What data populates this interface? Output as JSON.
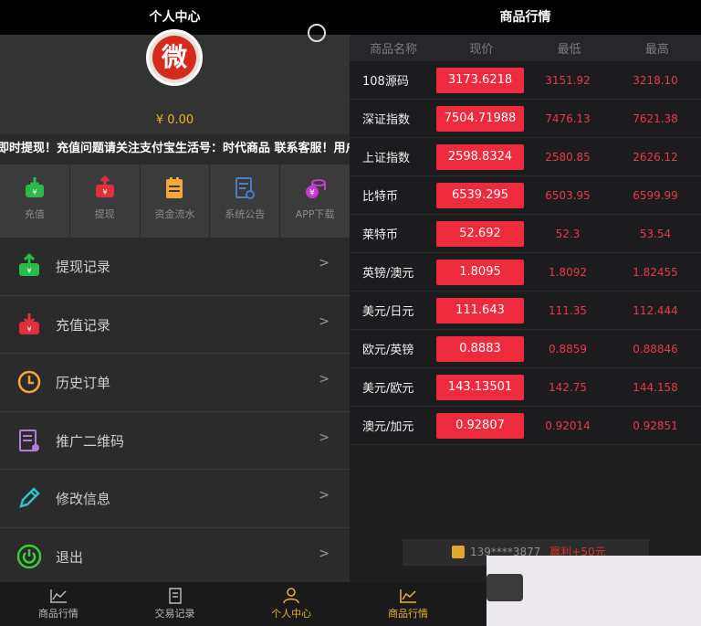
{
  "left": {
    "title": "个人中心",
    "balance": "¥ 0.00",
    "notice": "即时提现！充值问题请关注支付宝生活号：时代商品 联系客服！用户",
    "quick_actions": [
      {
        "label": "充值",
        "icon": "deposit-icon",
        "color": "#2bbb4a"
      },
      {
        "label": "提现",
        "icon": "withdraw-icon",
        "color": "#e0303d"
      },
      {
        "label": "资金流水",
        "icon": "ledger-icon",
        "color": "#f1a93a"
      },
      {
        "label": "系统公告",
        "icon": "announcement-icon",
        "color": "#4a7fc2"
      },
      {
        "label": "APP下载",
        "icon": "coins-icon",
        "color": "#c53ad0"
      }
    ],
    "menu": [
      {
        "label": "提现记录",
        "icon": "withdraw-record-icon"
      },
      {
        "label": "充值记录",
        "icon": "deposit-record-icon"
      },
      {
        "label": "历史订单",
        "icon": "clock-icon"
      },
      {
        "label": "推广二维码",
        "icon": "qrcode-doc-icon"
      },
      {
        "label": "修改信息",
        "icon": "pencil-icon"
      },
      {
        "label": "退出",
        "icon": "power-icon"
      }
    ],
    "chevron": ">",
    "tabs": [
      {
        "label": "商品行情",
        "icon": "chart-icon"
      },
      {
        "label": "交易记录",
        "icon": "records-icon"
      },
      {
        "label": "个人中心",
        "icon": "user-icon"
      }
    ]
  },
  "right": {
    "title": "商品行情",
    "headers": [
      "商品名称",
      "现价",
      "最低",
      "最高"
    ],
    "rows": [
      {
        "name": "108源码",
        "price": "3173.6218",
        "low": "3151.92",
        "high": "3218.10"
      },
      {
        "name": "深证指数",
        "price": "7504.71988",
        "low": "7476.13",
        "high": "7621.38"
      },
      {
        "name": "上证指数",
        "price": "2598.8324",
        "low": "2580.85",
        "high": "2626.12"
      },
      {
        "name": "比特币",
        "price": "6539.295",
        "low": "6503.95",
        "high": "6599.99"
      },
      {
        "name": "莱特币",
        "price": "52.692",
        "low": "52.3",
        "high": "53.54"
      },
      {
        "name": "英镑/澳元",
        "price": "1.8095",
        "low": "1.8092",
        "high": "1.82455"
      },
      {
        "name": "美元/日元",
        "price": "111.643",
        "low": "111.35",
        "high": "112.444"
      },
      {
        "name": "欧元/英镑",
        "price": "0.8883",
        "low": "0.8859",
        "high": "0.88846"
      },
      {
        "name": "美元/欧元",
        "price": "143.13501",
        "low": "142.75",
        "high": "144.158"
      },
      {
        "name": "澳元/加元",
        "price": "0.92807",
        "low": "0.92014",
        "high": "0.92851"
      }
    ],
    "ticker": {
      "user": "139****3877",
      "profit": "赢利+50元"
    },
    "tab_label": "商品行情"
  },
  "colors": {
    "accent": "#e7b23a",
    "price_bg": "#ee2a3d",
    "loss_text": "#e6394a"
  }
}
